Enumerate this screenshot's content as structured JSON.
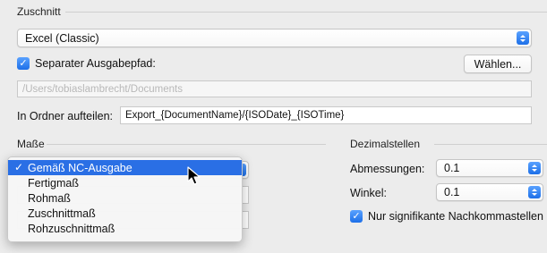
{
  "zuschnitt": {
    "section_label": "Zuschnitt",
    "format_value": "Excel (Classic)",
    "separater_label": "Separater Ausgabepfad:",
    "separater_checked": true,
    "waehlen_label": "Wählen...",
    "path_value": "/Users/tobiaslambrecht/Documents",
    "ordner_label": "In Ordner aufteilen:",
    "ordner_value": "Export_{DocumentName}/{ISODate}_{ISOTime}"
  },
  "masse": {
    "section_label": "Maße",
    "menu_items": [
      {
        "label": "Gemäß NC-Ausgabe",
        "selected": true
      },
      {
        "label": "Fertigmaß",
        "selected": false
      },
      {
        "label": "Rohmaß",
        "selected": false
      },
      {
        "label": "Zuschnittmaß",
        "selected": false
      },
      {
        "label": "Rohzuschnittmaß",
        "selected": false
      }
    ],
    "check_glyph": "✓"
  },
  "dezimalstellen": {
    "section_label": "Dezimalstellen",
    "abmessungen_label": "Abmessungen:",
    "abmessungen_value": "0.1",
    "winkel_label": "Winkel:",
    "winkel_value": "0.1",
    "signifikant_label": "Nur signifikante Nachkommastellen",
    "signifikant_checked": true
  },
  "icons": {
    "checkmark": "✓"
  },
  "colors": {
    "accent": "#1d6fe8",
    "selection": "#2a6fe5",
    "background": "#ececec"
  }
}
